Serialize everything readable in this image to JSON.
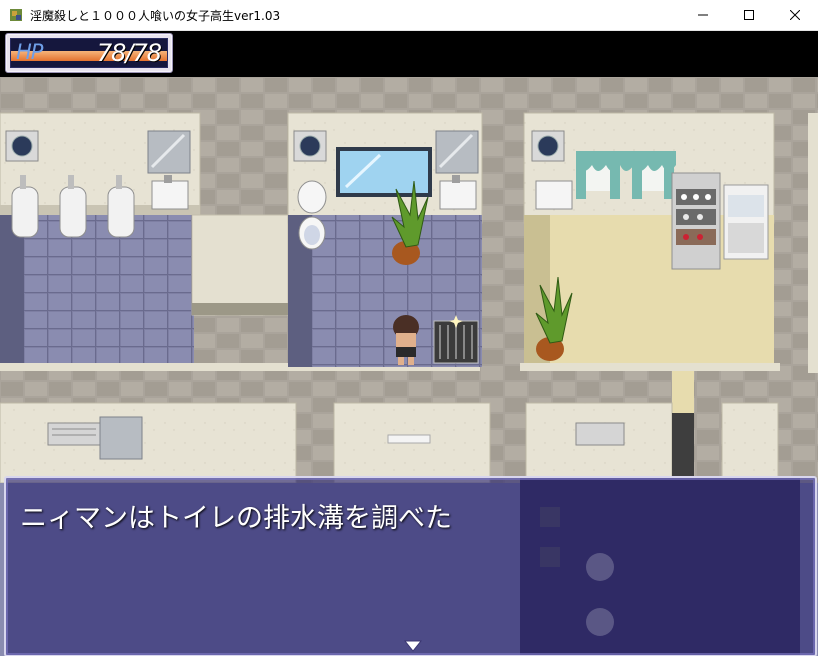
{
  "window": {
    "title": "淫魔殺しと１０００人喰いの女子高生ver1.03",
    "icon": "game-app-icon",
    "controls": [
      "minimize-icon",
      "maximize-icon",
      "close-icon"
    ]
  },
  "hud": {
    "hp_label": "HP",
    "hp_value": "78/78",
    "hp_fraction": 1.0,
    "hp_bar_color": "#e4722f"
  },
  "map": {
    "scene": "school-restroom-hallway",
    "tiles": [
      "urinal",
      "sink",
      "toilet",
      "window",
      "potted-plant",
      "floor-drain",
      "kitchen-shelf",
      "washing-machine",
      "air-conditioner",
      "telephone"
    ],
    "player": "player-character"
  },
  "message": {
    "text": "ニィマンはトイレの排水溝を調べた",
    "continue_icon": "next-arrow-icon"
  }
}
